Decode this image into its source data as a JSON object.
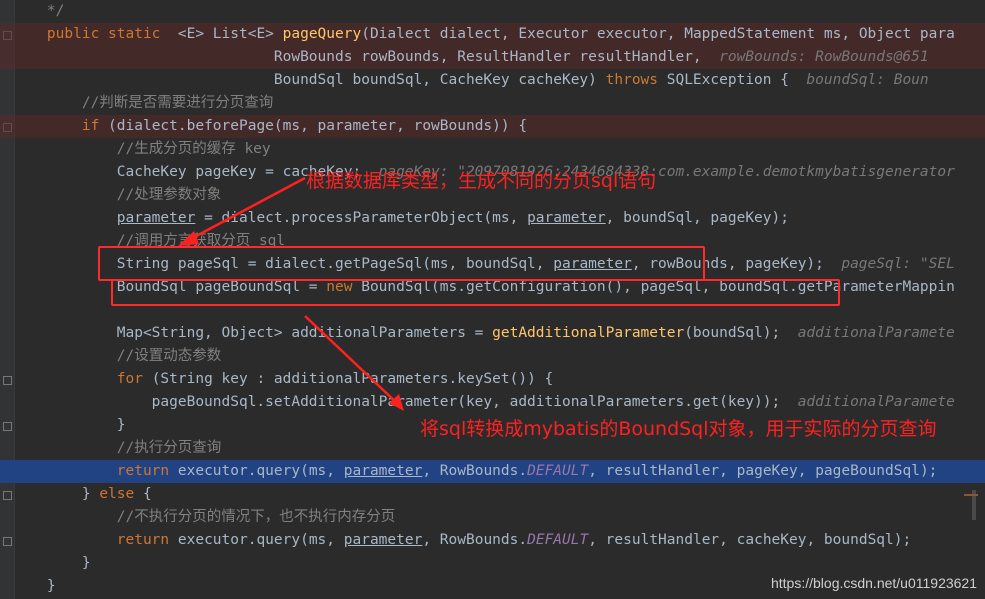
{
  "editor": {
    "lines": [
      {
        "tokens": [
          {
            "t": "    */",
            "c": "cm"
          }
        ]
      },
      {
        "tokens": [
          {
            "t": "    public static ",
            "c": "kw"
          },
          {
            "t": " <E> List<E> "
          },
          {
            "t": "pageQuery",
            "c": "fn"
          },
          {
            "t": "(Dialect dialect, Executor executor, MappedStatement ms, Object para"
          }
        ]
      },
      {
        "tokens": [
          {
            "t": "                              RowBounds rowBounds, ResultHandler resultHandler,  "
          },
          {
            "t": "rowBounds: RowBounds@651",
            "c": "hint"
          }
        ]
      },
      {
        "tokens": [
          {
            "t": "                              BoundSql boundSql, CacheKey cacheKey) "
          },
          {
            "t": "throws",
            "c": "kw"
          },
          {
            "t": " SQLException {  "
          },
          {
            "t": "boundSql: Boun",
            "c": "hint"
          }
        ]
      },
      {
        "tokens": [
          {
            "t": "        //判断是否需要进行分页查询",
            "c": "cm"
          }
        ]
      },
      {
        "tokens": [
          {
            "t": "        "
          },
          {
            "t": "if",
            "c": "kw"
          },
          {
            "t": " (dialect.beforePage(ms, parameter, rowBounds)) {"
          }
        ]
      },
      {
        "tokens": [
          {
            "t": "            //生成分页的缓存 key",
            "c": "cm"
          }
        ]
      },
      {
        "tokens": [
          {
            "t": "            CacheKey pageKey = cacheKey;  "
          },
          {
            "t": "pageKey: \"2097081926:2434684338:com.example.demotkmybatisgenerator",
            "c": "hint"
          }
        ]
      },
      {
        "tokens": [
          {
            "t": "            //处理参数对象",
            "c": "cm"
          }
        ]
      },
      {
        "tokens": [
          {
            "t": "            "
          },
          {
            "t": "parameter",
            "c": "ul"
          },
          {
            "t": " = dialect.processParameterObject(ms, "
          },
          {
            "t": "parameter",
            "c": "ul"
          },
          {
            "t": ", boundSql, pageKey);"
          }
        ]
      },
      {
        "tokens": [
          {
            "t": "            //调用方言获取分页 sql",
            "c": "cm"
          }
        ]
      },
      {
        "tokens": [
          {
            "t": "            String pageSql = dialect.getPageSql(ms, boundSql, "
          },
          {
            "t": "parameter",
            "c": "ul"
          },
          {
            "t": ", rowBounds, pageKey);  "
          },
          {
            "t": "pageSql: \"SEL",
            "c": "hint"
          }
        ]
      },
      {
        "tokens": [
          {
            "t": "            BoundSql pageBoundSql = "
          },
          {
            "t": "new",
            "c": "kw"
          },
          {
            "t": " BoundSql(ms.getConfiguration(), pageSql, boundSql.getParameterMappin"
          }
        ]
      },
      {
        "tokens": [
          {
            "t": ""
          }
        ]
      },
      {
        "tokens": [
          {
            "t": "            Map<String, Object> additionalParameters = "
          },
          {
            "t": "getAdditionalParameter",
            "c": "fn"
          },
          {
            "t": "(boundSql);  "
          },
          {
            "t": "additionalParamete",
            "c": "hint"
          }
        ]
      },
      {
        "tokens": [
          {
            "t": "            //设置动态参数",
            "c": "cm"
          }
        ]
      },
      {
        "tokens": [
          {
            "t": "            "
          },
          {
            "t": "for",
            "c": "kw"
          },
          {
            "t": " (String key : additionalParameters.keySet()) {"
          }
        ]
      },
      {
        "tokens": [
          {
            "t": "                pageBoundSql.setAdditionalParameter(key, additionalParameters.get(key));  "
          },
          {
            "t": "additionalParamete",
            "c": "hint"
          }
        ]
      },
      {
        "tokens": [
          {
            "t": "            }"
          }
        ]
      },
      {
        "tokens": [
          {
            "t": "            //执行分页查询",
            "c": "cm"
          }
        ]
      },
      {
        "tokens": [
          {
            "t": "            "
          },
          {
            "t": "return",
            "c": "kw"
          },
          {
            "t": " executor.query(ms, "
          },
          {
            "t": "parameter",
            "c": "ul"
          },
          {
            "t": ", RowBounds."
          },
          {
            "t": "DEFAULT",
            "c": "st"
          },
          {
            "t": ", resultHandler, pageKey, pageBoundSql);"
          }
        ]
      },
      {
        "tokens": [
          {
            "t": "        } "
          },
          {
            "t": "else",
            "c": "kw"
          },
          {
            "t": " {"
          }
        ]
      },
      {
        "tokens": [
          {
            "t": "            //不执行分页的情况下，也不执行内存分页",
            "c": "cm"
          }
        ]
      },
      {
        "tokens": [
          {
            "t": "            "
          },
          {
            "t": "return",
            "c": "kw"
          },
          {
            "t": " executor.query(ms, "
          },
          {
            "t": "parameter",
            "c": "ul"
          },
          {
            "t": ", RowBounds."
          },
          {
            "t": "DEFAULT",
            "c": "st"
          },
          {
            "t": ", resultHandler, cacheKey, boundSql);"
          }
        ]
      },
      {
        "tokens": [
          {
            "t": "        }"
          }
        ]
      },
      {
        "tokens": [
          {
            "t": "    }"
          }
        ]
      }
    ]
  },
  "annotations": {
    "note1": "根据数据库类型，生成不同的分页sql语句",
    "note2": "将sql转换成mybatis的BoundSql对象，用于实际的分页查询"
  },
  "watermark": "https://blog.csdn.net/u011923621",
  "colors": {
    "background": "#2b2b2b",
    "keyword": "#cc7832",
    "method": "#ffc66d",
    "comment": "#808080",
    "text": "#a9b7c6",
    "annotation_red": "#ff2020",
    "current_line": "#214283"
  }
}
